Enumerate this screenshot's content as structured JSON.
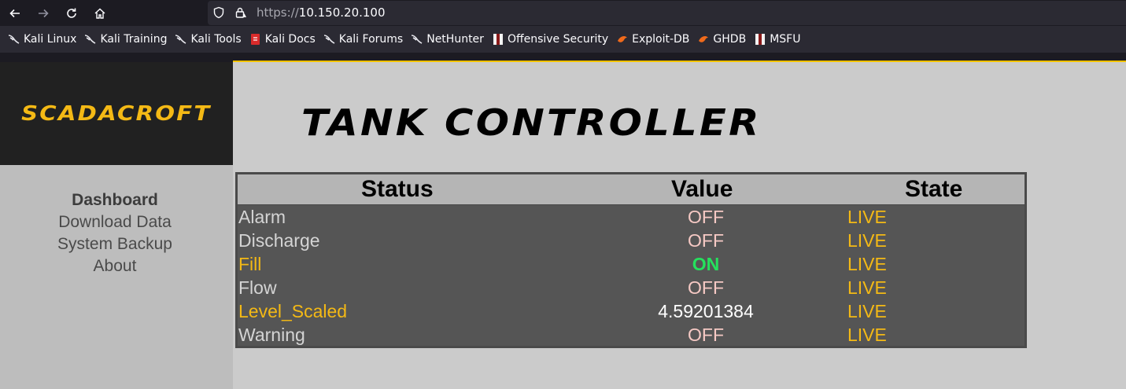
{
  "browser": {
    "url_protocol": "https://",
    "url_host": "10.150.20.100",
    "bookmarks": [
      {
        "label": "Kali Linux",
        "icon": "kali-dragon-icon"
      },
      {
        "label": "Kali Training",
        "icon": "kali-dragon-icon"
      },
      {
        "label": "Kali Tools",
        "icon": "kali-dragon-icon"
      },
      {
        "label": "Kali Docs",
        "icon": "kali-docs-icon"
      },
      {
        "label": "Kali Forums",
        "icon": "kali-dragon-icon"
      },
      {
        "label": "NetHunter",
        "icon": "kali-dragon-icon"
      },
      {
        "label": "Offensive Security",
        "icon": "offsec-icon"
      },
      {
        "label": "Exploit-DB",
        "icon": "exploit-db-icon"
      },
      {
        "label": "GHDB",
        "icon": "exploit-db-icon"
      },
      {
        "label": "MSFU",
        "icon": "offsec-icon"
      }
    ]
  },
  "sidebar": {
    "logo": "SCADACROFT",
    "nav": [
      "Dashboard",
      "Download Data",
      "System Backup",
      "About"
    ]
  },
  "main": {
    "title": "TANK CONTROLLER",
    "columns": [
      "Status",
      "Value",
      "State"
    ],
    "rows": [
      {
        "status": "Alarm",
        "value": "OFF",
        "state": "LIVE",
        "status_color": "grey",
        "value_color": "pink"
      },
      {
        "status": "Discharge",
        "value": "OFF",
        "state": "LIVE",
        "status_color": "grey",
        "value_color": "pink"
      },
      {
        "status": "Fill",
        "value": "ON",
        "state": "LIVE",
        "status_color": "gold",
        "value_color": "green"
      },
      {
        "status": "Flow",
        "value": "OFF",
        "state": "LIVE",
        "status_color": "grey",
        "value_color": "pink"
      },
      {
        "status": "Level_Scaled",
        "value": "4.59201384",
        "state": "LIVE",
        "status_color": "gold",
        "value_color": "white"
      },
      {
        "status": "Warning",
        "value": "OFF",
        "state": "LIVE",
        "status_color": "grey",
        "value_color": "pink"
      }
    ]
  },
  "colors": {
    "accent": "#f4b915",
    "on": "#25e15d",
    "off": "#f6c9c4",
    "table_bg": "#555555"
  }
}
